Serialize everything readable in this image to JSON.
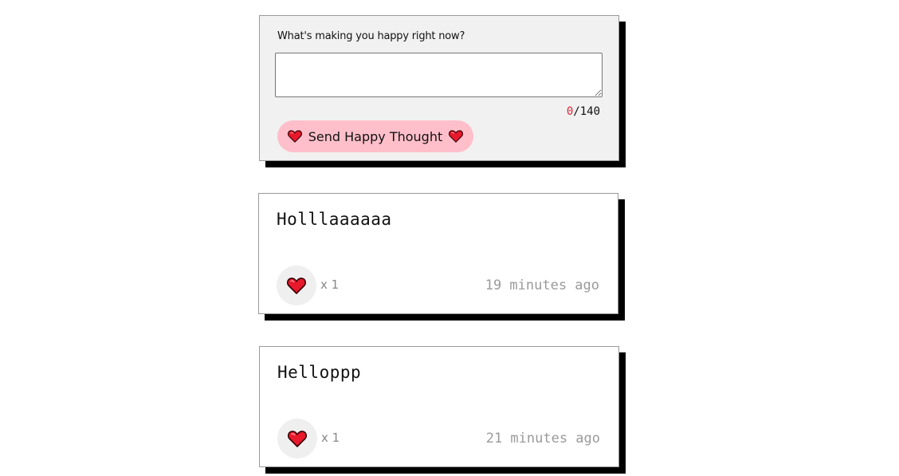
{
  "form": {
    "prompt": "What's making you happy right now?",
    "input_value": "",
    "counter_current": "0",
    "counter_max": "/140",
    "send_label": "Send Happy Thought"
  },
  "thoughts": [
    {
      "message": "Holllaaaaaa",
      "likes_label": "x 1",
      "time_ago": "19 minutes ago"
    },
    {
      "message": "Helloppp",
      "likes_label": "x 1",
      "time_ago": "21 minutes ago"
    }
  ],
  "icons": {
    "heart": "heart-icon"
  },
  "colors": {
    "accent": "#ffbfca",
    "heart": "#e8192c",
    "shadow": "#000000",
    "form_bg": "#f1f1f1",
    "counter_highlight": "#e0233a",
    "muted_text": "#9a9a9a"
  }
}
